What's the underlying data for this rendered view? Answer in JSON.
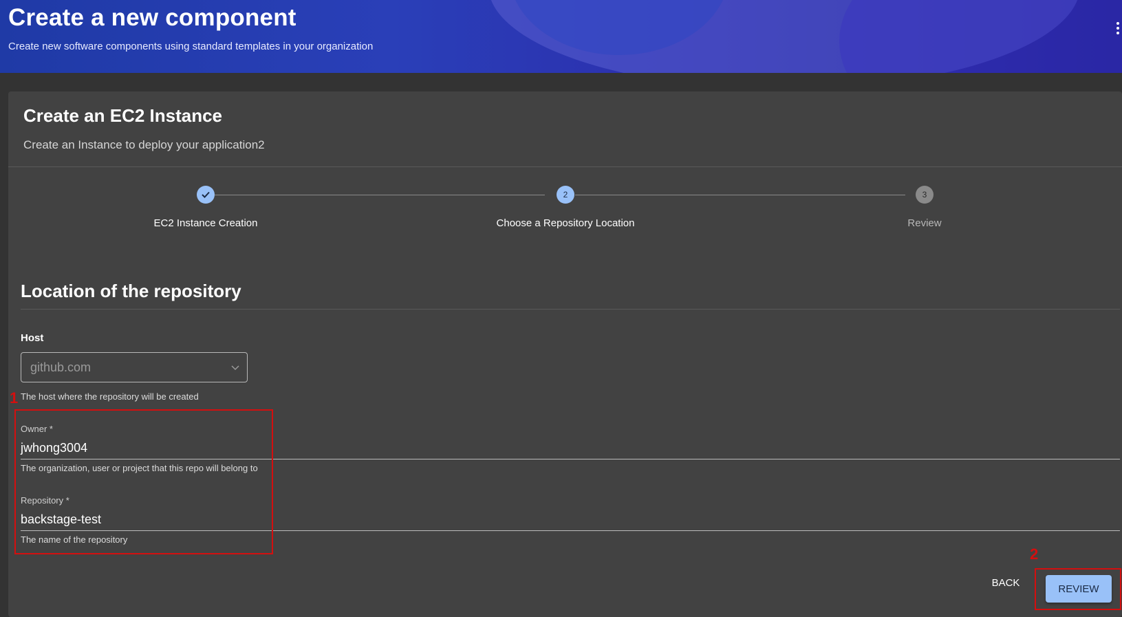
{
  "header": {
    "title": "Create a new component",
    "subtitle": "Create new software components using standard templates in your organization"
  },
  "template": {
    "title": "Create an EC2 Instance",
    "description": "Create an Instance to deploy your application2"
  },
  "stepper": {
    "steps": [
      {
        "label": "EC2 Instance Creation",
        "state": "completed",
        "icon": "check-icon"
      },
      {
        "label": "Choose a Repository Location",
        "state": "active",
        "number": "2"
      },
      {
        "label": "Review",
        "state": "pending",
        "number": "3"
      }
    ]
  },
  "form": {
    "section_title": "Location of the repository",
    "host": {
      "label": "Host",
      "value": "github.com",
      "helper": "The host where the repository will be created"
    },
    "owner": {
      "label": "Owner *",
      "value": "jwhong3004",
      "helper": "The organization, user or project that this repo will belong to"
    },
    "repository": {
      "label": "Repository *",
      "value": "backstage-test",
      "helper": "The name of the repository"
    }
  },
  "actions": {
    "back_label": "BACK",
    "review_label": "REVIEW"
  },
  "annotations": {
    "first": "1",
    "second": "2",
    "color": "#d40f0f"
  },
  "colors": {
    "active_step": "#99c1f8",
    "pending_step": "#8a8a8a",
    "primary_button": "#99c1f8"
  }
}
